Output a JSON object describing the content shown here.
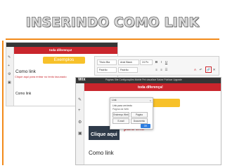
{
  "slide": {
    "title": "INSERINDO COMO LINK"
  },
  "shot1": {
    "banner": "toda diferença!",
    "button": "Exemplos",
    "heading": "Como link",
    "red_text": "Clique aqui para entrar no texto tacunado",
    "heading2": "Como link"
  },
  "toolbar": {
    "font_theme": "Título Bla",
    "font_family": "Arial Black",
    "font_size": "24 Px",
    "style1": "Padrão",
    "style2": "Padrão",
    "link_icon": "🔗",
    "icons": [
      "B",
      "I",
      "U"
    ]
  },
  "shot2": {
    "wix": "Wix",
    "menu": "Páginas   Site   Configurações   Mobile   Pré-visualizar   Salvar   Publicar   Upgrade",
    "banner": "toda diferença!",
    "yellow": "Link",
    "link_text": "Clique aqui",
    "red_text": "para entr",
    "heading": "Como link"
  },
  "dialog": {
    "title": "Link",
    "close": "×",
    "options": [
      "Link para um texto",
      "Página da Web",
      "E-mail",
      "Documento"
    ],
    "buttons": [
      "Endereço Web",
      "Página",
      "E-mail",
      "Documento"
    ],
    "ok": "OK"
  }
}
